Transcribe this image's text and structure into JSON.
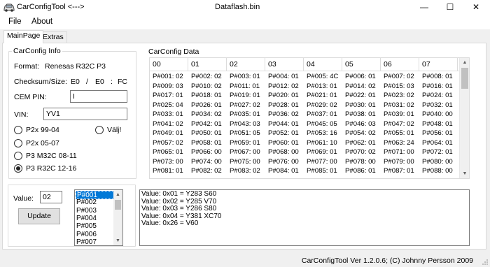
{
  "window": {
    "app_title": "CarConfigTool <--->",
    "doc_title": "Dataflash.bin",
    "min_glyph": "—",
    "max_glyph": "☐",
    "close_glyph": "✕"
  },
  "menu": {
    "file": "File",
    "about": "About"
  },
  "tabs": {
    "main": "MainPage",
    "extras": "Extras"
  },
  "info": {
    "group_title": "CarConfig Info",
    "format_label": "Format:",
    "format_value": "Renesas R32C P3",
    "checksum_label": "Checksum/Size:",
    "checksum_a": "E0",
    "sep": "/",
    "checksum_b": "E0",
    "colon": ":",
    "checksum_c": "FC",
    "cem_pin_label": "CEM PIN:",
    "cem_pin_value": "I",
    "vin_label": "VIN:",
    "vin_value": "YV1",
    "radios": {
      "p2x_9904": "P2x 99-04",
      "valj": "Välj!",
      "p2x_0507": "P2x 05-07",
      "p3_m32c": "P3 M32C 08-11",
      "p3_r32c": "P3 R32C  12-16"
    }
  },
  "grid": {
    "group_title": "CarConfig Data",
    "headers": [
      "00",
      "01",
      "02",
      "03",
      "04",
      "05",
      "06",
      "07"
    ],
    "rows": [
      [
        "P#001: 02",
        "P#002: 02",
        "P#003: 01",
        "P#004: 01",
        "P#005: 4C",
        "P#006: 01",
        "P#007: 02",
        "P#008: 01"
      ],
      [
        "P#009: 03",
        "P#010: 02",
        "P#011: 01",
        "P#012: 02",
        "P#013: 01",
        "P#014: 02",
        "P#015: 03",
        "P#016: 01"
      ],
      [
        "P#017: 01",
        "P#018: 01",
        "P#019: 01",
        "P#020: 01",
        "P#021: 01",
        "P#022: 01",
        "P#023: 02",
        "P#024: 01"
      ],
      [
        "P#025: 04",
        "P#026: 01",
        "P#027: 02",
        "P#028: 01",
        "P#029: 02",
        "P#030: 01",
        "P#031: 02",
        "P#032: 01"
      ],
      [
        "P#033: 01",
        "P#034: 02",
        "P#035: 01",
        "P#036: 02",
        "P#037: 01",
        "P#038: 01",
        "P#039: 01",
        "P#040: 00"
      ],
      [
        "P#041: 02",
        "P#042: 01",
        "P#043: 03",
        "P#044: 01",
        "P#045: 05",
        "P#046: 03",
        "P#047: 02",
        "P#048: 01"
      ],
      [
        "P#049: 01",
        "P#050: 01",
        "P#051: 05",
        "P#052: 01",
        "P#053: 16",
        "P#054: 02",
        "P#055: 01",
        "P#056: 01"
      ],
      [
        "P#057: 02",
        "P#058: 01",
        "P#059: 01",
        "P#060: 01",
        "P#061: 10",
        "P#062: 01",
        "P#063: 24",
        "P#064: 01"
      ],
      [
        "P#065: 01",
        "P#066: 00",
        "P#067: 00",
        "P#068: 00",
        "P#069: 01",
        "P#070: 02",
        "P#071: 00",
        "P#072: 01"
      ],
      [
        "P#073: 00",
        "P#074: 00",
        "P#075: 00",
        "P#076: 00",
        "P#077: 00",
        "P#078: 00",
        "P#079: 00",
        "P#080: 00"
      ],
      [
        "P#081: 01",
        "P#082: 02",
        "P#083: 02",
        "P#084: 01",
        "P#085: 01",
        "P#086: 01",
        "P#087: 01",
        "P#088: 00"
      ]
    ]
  },
  "edit": {
    "value_label": "Value:",
    "value": "02",
    "update_button": "Update",
    "list": [
      "P#001",
      "P#002",
      "P#003",
      "P#004",
      "P#005",
      "P#006",
      "P#007"
    ],
    "output": [
      "Value: 0x01 = Y283 S60",
      "Value: 0x02 = Y285 V70",
      "Value: 0x03 = Y286 S80",
      "Value: 0x04 = Y381 XC70",
      "Value: 0x26 = V60"
    ]
  },
  "status": "CarConfigTool Ver 1.2.0.6; (C) Johnny Persson 2009"
}
